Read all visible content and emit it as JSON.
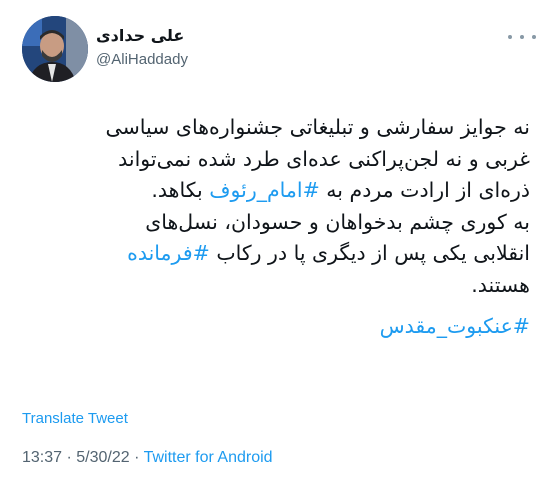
{
  "author": {
    "name": "علی حدادی",
    "handle": "@AliHaddady"
  },
  "tweet": {
    "lines": [
      [
        "نه جوایز سفارشی و تبلیغاتی جشنواره‌های سیاسی"
      ],
      [
        "غربی و نه لجن‌پراکنی عده‌ای طرد شده نمی‌تواند"
      ],
      [
        "ذره‌ای از ارادت مردم به ",
        "#امام_رئوف",
        " بکاهد."
      ],
      [
        "به کوری چشم بدخواهان و حسودان، نسل‌های"
      ],
      [
        "انقلابی یکی پس از دیگری پا در رکاب ",
        "#فرمانده"
      ],
      [
        "هستند."
      ]
    ],
    "hashtag_final": "#عنکبوت_مقدس"
  },
  "translate_label": "Translate Tweet",
  "meta": {
    "time": "13:37",
    "separator": " · ",
    "date": "5/30/22",
    "source": "Twitter for Android"
  },
  "colors": {
    "link": "#1d9bf0",
    "text": "#0f1419",
    "secondary": "#536471"
  },
  "icons": {
    "more": "more-dots-icon"
  }
}
